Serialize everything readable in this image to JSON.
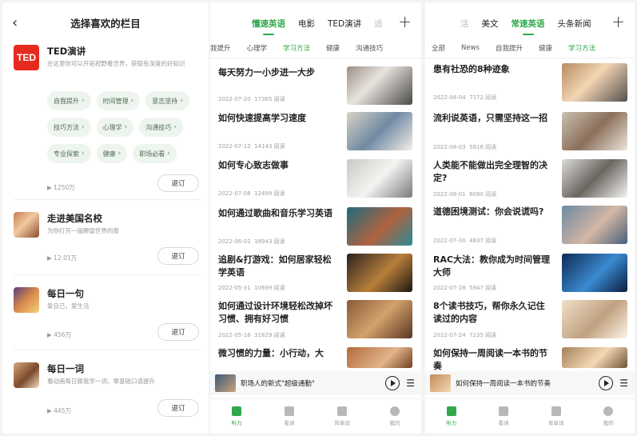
{
  "left_panel": {
    "title": "选择喜欢的栏目",
    "subscriptions": [
      {
        "name": "TED演讲",
        "logo_text": "TED",
        "description": "在这里你可以开拓视野看世界，获取有深度的好知识",
        "tags": [
          "自我提升",
          "时间管理",
          "意志坚持",
          "技巧方法",
          "心理学",
          "沟通技巧",
          "专业探索",
          "健康",
          "职场必看"
        ],
        "count": "▶ 1250万",
        "button": "退订"
      },
      {
        "name": "走进美国名校",
        "description": "为你打开一扇瞭望世界的窗",
        "count": "▶ 12.01万",
        "button": "退订"
      },
      {
        "name": "每日一句",
        "description": "爱自己，爱生活",
        "count": "▶ 456万",
        "button": "退订"
      },
      {
        "name": "每日一词",
        "description": "看动画每日跟我学一词，零基础口语提升",
        "count": "▶ 445万",
        "button": "退订"
      }
    ]
  },
  "middle_panel": {
    "top_tabs": [
      "懂速英语",
      "电影",
      "TED演讲",
      "适"
    ],
    "active_top_tab": "懂速英语",
    "sub_tabs": [
      "我提升",
      "心理学",
      "学习方法",
      "健康",
      "沟通技巧"
    ],
    "active_sub_tab": "学习方法",
    "articles": [
      {
        "title": "每天努力一小步进一大步",
        "date": "2022-07-20",
        "reads": "17365 阅读"
      },
      {
        "title": "如何快速提高学习速度",
        "date": "2022-07-12",
        "reads": "14143 阅读"
      },
      {
        "title": "如何专心致志做事",
        "date": "2022-07-08",
        "reads": "12499 阅读"
      },
      {
        "title": "如何通过歌曲和音乐学习英语",
        "date": "2022-06-02",
        "reads": "18943 阅读"
      },
      {
        "title": "追剧&打游戏：如何居家轻松学英语",
        "date": "2022-05-31",
        "reads": "10699 阅读"
      },
      {
        "title": "如何通过设计环境轻松改掉坏习惯、拥有好习惯",
        "date": "2022-05-16",
        "reads": "31829 阅读"
      },
      {
        "title": "微习惯的力量：小行动，大",
        "date": "",
        "reads": ""
      }
    ],
    "player_title": "职场人的新式\"超级通勤\"",
    "nav": [
      "听力",
      "看读",
      "背单词",
      "我的"
    ]
  },
  "right_panel": {
    "top_tabs": [
      "活",
      "美文",
      "常速英语",
      "头条新闻"
    ],
    "active_top_tab": "常速英语",
    "sub_tabs": [
      "全部",
      "News",
      "自我提升",
      "健康",
      "学习方法"
    ],
    "active_sub_tab": "学习方法",
    "articles": [
      {
        "title": "患有社恐的8种迹象",
        "date": "2022-08-04",
        "reads": "7172 阅读"
      },
      {
        "title": "流利说英语，只需坚持这一招",
        "date": "2022-08-03",
        "reads": "5818 阅读"
      },
      {
        "title": "人类能不能做出完全理智的决定?",
        "date": "2022-08-01",
        "reads": "6090 阅读"
      },
      {
        "title": "道德困境测试：你会说谎吗?",
        "date": "2022-07-30",
        "reads": "4837 阅读"
      },
      {
        "title": "RAC大法：教你成为时间管理大师",
        "date": "2022-07-28",
        "reads": "5947 阅读"
      },
      {
        "title": "8个读书技巧，帮你永久记住读过的内容",
        "date": "2022-07-24",
        "reads": "7235 阅读"
      },
      {
        "title": "如何保持一周阅读一本书的节奏",
        "date": "",
        "reads": ""
      }
    ],
    "player_title": "如何保持一周阅读一本书的节奏",
    "nav": [
      "听力",
      "看读",
      "背单词",
      "我的"
    ]
  }
}
